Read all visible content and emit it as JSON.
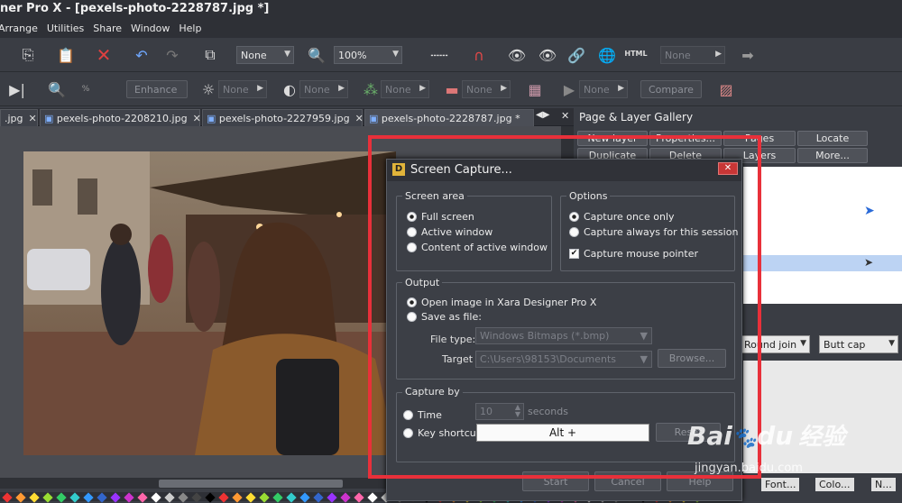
{
  "window": {
    "title": "ner Pro X - [pexels-photo-2228787.jpg *]"
  },
  "menu": [
    "Arrange",
    "Utilities",
    "Share",
    "Window",
    "Help"
  ],
  "toolbar1": {
    "quality": "None",
    "zoom": "100%",
    "html_label": "HTML",
    "right_field": "None"
  },
  "toolbar2": {
    "enhance": "Enhance",
    "none1": "None",
    "none2": "None",
    "none3": "None",
    "none4": "None",
    "none5": "None",
    "compare": "Compare"
  },
  "tabs": [
    {
      "label": ".jpg"
    },
    {
      "label": "pexels-photo-2208210.jpg"
    },
    {
      "label": "pexels-photo-2227959.jpg"
    },
    {
      "label": "pexels-photo-2228787.jpg *"
    }
  ],
  "gallery": {
    "title": "Page & Layer Gallery",
    "row1": [
      "New layer",
      "Properties...",
      "Pages",
      "Locate"
    ],
    "row2": [
      "Duplicate",
      "Delete",
      "Layers",
      "More..."
    ],
    "line_join": "Round join",
    "line_cap": "Butt cap",
    "bottom_tabs": [
      "Font...",
      "Colo...",
      "N..."
    ]
  },
  "dialog": {
    "title": "Screen Capture...",
    "screen_area": {
      "legend": "Screen area",
      "options": [
        "Full screen",
        "Active window",
        "Content of active window"
      ],
      "selected": 0
    },
    "options": {
      "legend": "Options",
      "radios": [
        "Capture once only",
        "Capture always for this session"
      ],
      "selected": 0,
      "checkbox": "Capture mouse pointer",
      "checked": true
    },
    "output": {
      "legend": "Output",
      "radios": [
        "Open image in Xara Designer Pro X",
        "Save as file:"
      ],
      "selected": 0,
      "file_type_label": "File type:",
      "file_type": "Windows Bitmaps (*.bmp)",
      "target_label": "Target",
      "target": "C:\\Users\\98153\\Documents",
      "browse": "Browse..."
    },
    "capture_by": {
      "legend": "Capture by",
      "time": "Time",
      "time_value": "10",
      "seconds": "seconds",
      "key_shortcut": "Key shortcut",
      "shortcut_value": "Alt +",
      "reset": "Reset"
    },
    "buttons": {
      "start": "Start",
      "cancel": "Cancel",
      "help": "Help"
    }
  },
  "watermark": {
    "brand": "Bai",
    "brand2": "du",
    "cn": "经验",
    "url": "jingyan.baidu.com"
  },
  "colors": {
    "highlight_box": "#e8303a",
    "dialog_close": "#c83636",
    "selection": "#bcd3f3"
  }
}
